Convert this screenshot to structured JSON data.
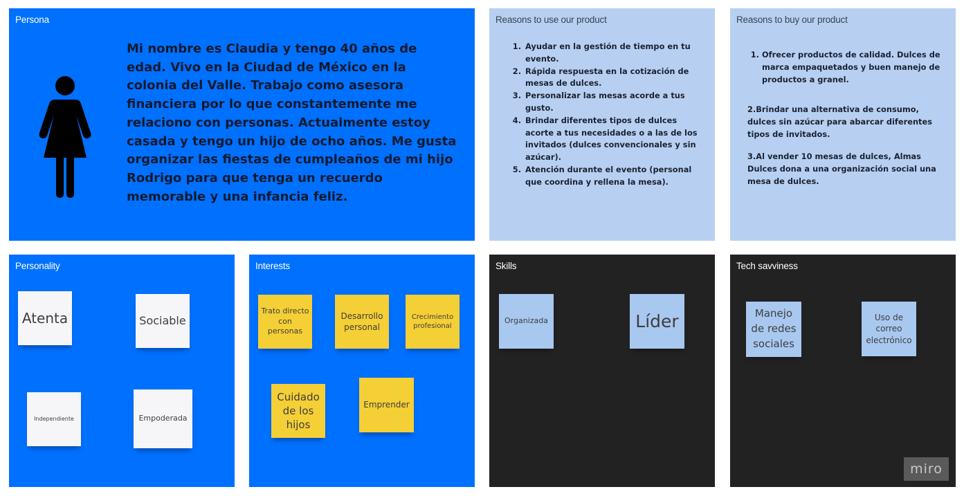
{
  "persona": {
    "title": "Persona",
    "icon": "woman-figure-icon",
    "description": "Mi nombre es Claudia y tengo 40 años de edad. Vivo en la Ciudad de México en la colonia del Valle.  Trabajo como asesora financiera por lo que constantemente me relaciono con personas. Actualmente estoy casada y tengo un hijo de ocho años. Me gusta organizar las fiestas de cumpleaños de mi hijo Rodrigo para que tenga un recuerdo memorable y una infancia feliz."
  },
  "reasons_use": {
    "title": "Reasons to use our product",
    "items": [
      "Ayudar en la gestión de tiempo en tu evento.",
      "Rápida respuesta en la cotización de mesas de dulces.",
      "Personalizar las mesas acorde a tus gusto.",
      "Brindar diferentes tipos de dulces acorte a tus necesidades o a las de los invitados (dulces convencionales y sin azúcar).",
      "Atención durante el evento (personal que coordina y rellena la mesa)."
    ]
  },
  "reasons_buy": {
    "title": "Reasons to buy our product",
    "item1": "Ofrecer productos de calidad. Dulces de marca empaquetados y buen manejo de productos a granel.",
    "para2": "2.Brindar una alternativa de consumo, dulces sin azúcar para abarcar diferentes tipos de invitados.",
    "para3": "3.Al vender 10 mesas de dulces, Almas Dulces dona a una organización social una mesa de dulces."
  },
  "personality": {
    "title": "Personality",
    "notes": [
      "Atenta",
      "Sociable",
      "Independiente",
      "Empoderada"
    ]
  },
  "interests": {
    "title": "Interests",
    "notes": [
      "Trato directo con personas",
      "Desarrollo personal",
      "Crecimiento profesional",
      "Cuidado de los hijos",
      "Emprender"
    ]
  },
  "skills": {
    "title": "Skills",
    "notes": [
      "Organizada",
      "Líder"
    ]
  },
  "tech": {
    "title": "Tech savviness",
    "notes": [
      "Manejo de redes sociales",
      "Uso de correo electrónico"
    ]
  },
  "brand": {
    "logo": "miro"
  },
  "colors": {
    "frame_blue": "#0070ff",
    "frame_light": "#b7d0f2",
    "frame_dark": "#232223",
    "note_yellow": "#f4cf36",
    "note_white": "#f6f6f8",
    "note_lightblue": "#a8c8f0"
  }
}
